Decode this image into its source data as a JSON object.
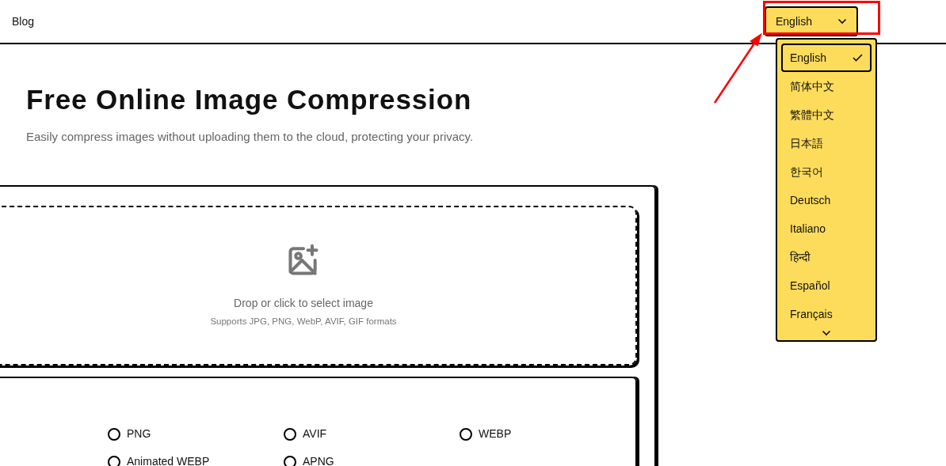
{
  "nav": {
    "blog_link": "Blog",
    "language_button": "English"
  },
  "language_menu": {
    "items": [
      {
        "label": "English",
        "selected": true
      },
      {
        "label": "简体中文",
        "selected": false
      },
      {
        "label": "繁體中文",
        "selected": false
      },
      {
        "label": "日本語",
        "selected": false
      },
      {
        "label": "한국어",
        "selected": false
      },
      {
        "label": "Deutsch",
        "selected": false
      },
      {
        "label": "Italiano",
        "selected": false
      },
      {
        "label": "हिन्दी",
        "selected": false
      },
      {
        "label": "Español",
        "selected": false
      },
      {
        "label": "Français",
        "selected": false
      }
    ]
  },
  "hero": {
    "title": "Free Online Image Compression",
    "subtitle": "Easily compress images without uploading them to the cloud, protecting your privacy."
  },
  "dropzone": {
    "prompt": "Drop or click to select image",
    "formats_note": "Supports JPG, PNG, WebP, AVIF, GIF formats"
  },
  "output_formats": [
    {
      "label": "PNG",
      "selected": false
    },
    {
      "label": "AVIF",
      "selected": false
    },
    {
      "label": "WEBP",
      "selected": false
    },
    {
      "label": "Animated WEBP",
      "selected": false
    },
    {
      "label": "APNG",
      "selected": false
    }
  ]
}
